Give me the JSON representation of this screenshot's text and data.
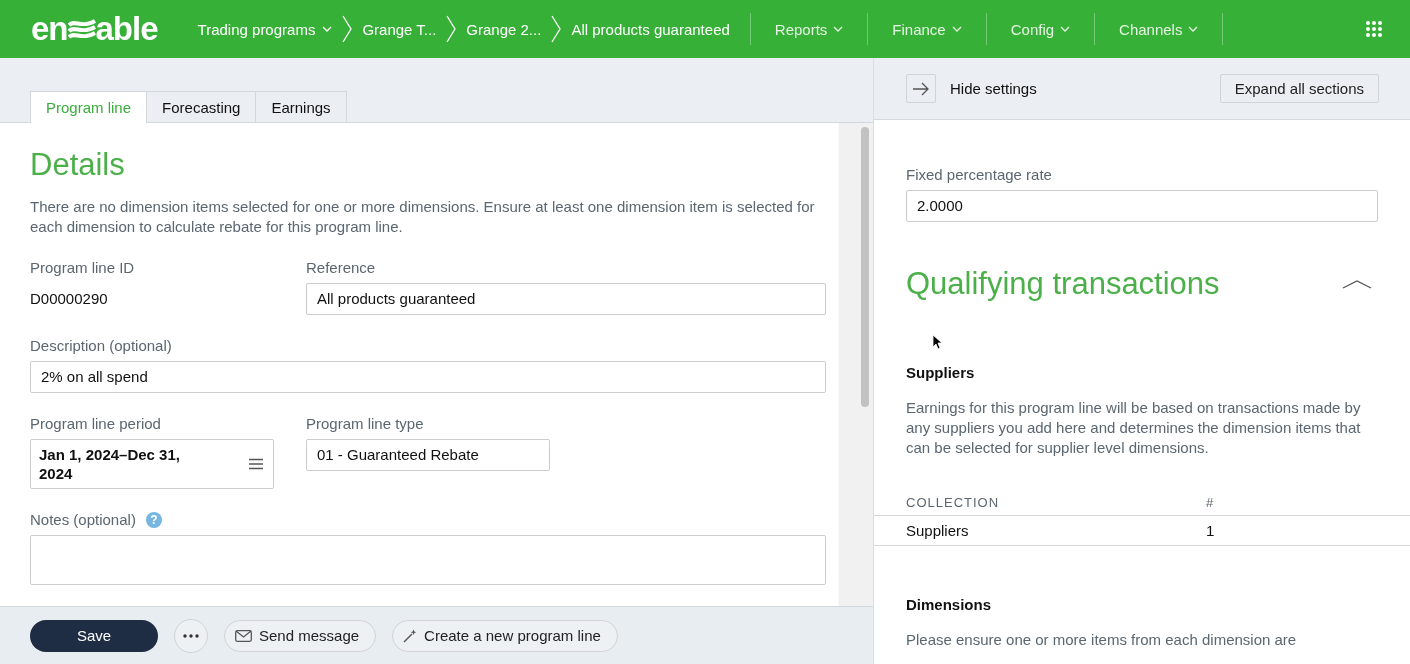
{
  "logo": {
    "left": "en",
    "right": "able"
  },
  "breadcrumbs": [
    {
      "label": "Trading programs",
      "dropdown": true
    },
    {
      "label": "Grange T...",
      "dropdown": false
    },
    {
      "label": "Grange 2...",
      "dropdown": false
    },
    {
      "label": "All products guaranteed",
      "dropdown": false
    }
  ],
  "nav": [
    {
      "label": "Reports"
    },
    {
      "label": "Finance"
    },
    {
      "label": "Config"
    },
    {
      "label": "Channels"
    }
  ],
  "tabs": [
    {
      "label": "Program line",
      "selected": true
    },
    {
      "label": "Forecasting",
      "selected": false
    },
    {
      "label": "Earnings",
      "selected": false
    }
  ],
  "details": {
    "title": "Details",
    "warning": "There are no dimension items selected for one or more dimensions. Ensure at least one dimension item is selected for each dimension to calculate rebate for this program line.",
    "program_line_id": {
      "label": "Program line ID",
      "value": "D00000290"
    },
    "reference": {
      "label": "Reference",
      "value": "All products guaranteed"
    },
    "description": {
      "label": "Description (optional)",
      "value": "2% on all spend"
    },
    "period": {
      "label": "Program line period",
      "value": "Jan 1, 2024–Dec 31, 2024"
    },
    "type": {
      "label": "Program line type",
      "value": "01 - Guaranteed Rebate"
    },
    "notes": {
      "label": "Notes (optional)",
      "help": "?"
    }
  },
  "footer": {
    "save": "Save",
    "send": "Send message",
    "create": "Create a new program line"
  },
  "settings": {
    "hide": "Hide settings",
    "expand": "Expand all sections",
    "rate": {
      "label": "Fixed percentage rate",
      "value": "2.0000"
    },
    "section_title": "Qualifying transactions",
    "expanded": true,
    "suppliers": {
      "title": "Suppliers",
      "text": "Earnings for this program line will be based on transactions made by any suppliers you add here and determines the dimension items that can be selected for supplier level dimensions.",
      "columns": [
        "COLLECTION",
        "#"
      ],
      "rows": [
        [
          "Suppliers",
          "1"
        ]
      ]
    },
    "dimensions": {
      "title": "Dimensions",
      "text": "Please ensure one or more items from each dimension are"
    }
  }
}
